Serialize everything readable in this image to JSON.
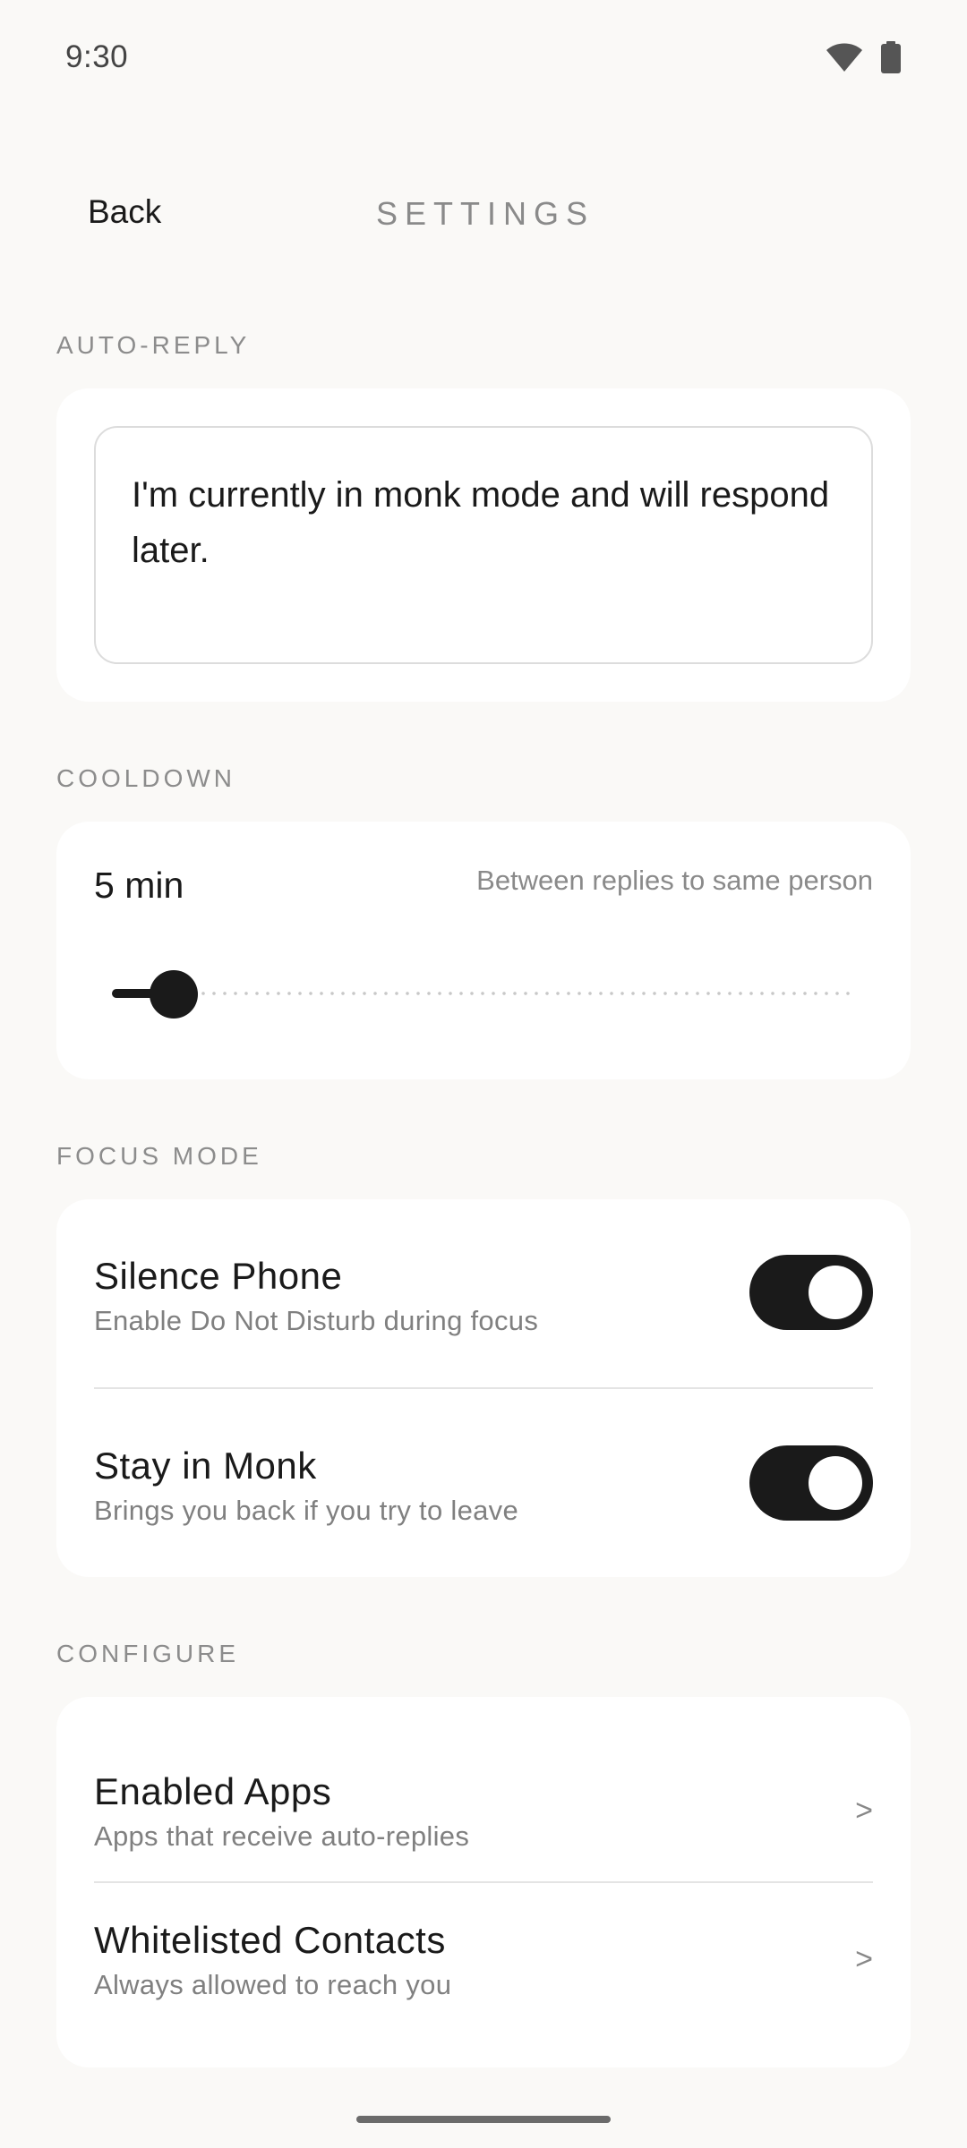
{
  "status_bar": {
    "time": "9:30",
    "wifi_icon": "wifi-icon",
    "battery_icon": "battery-icon"
  },
  "header": {
    "back_label": "Back",
    "title": "SETTINGS"
  },
  "auto_reply": {
    "section_label": "AUTO-REPLY",
    "message": "I'm currently in monk mode and will respond later."
  },
  "cooldown": {
    "section_label": "COOLDOWN",
    "value_label": "5 min",
    "description": "Between replies to same person",
    "slider_fraction": 0.05
  },
  "focus_mode": {
    "section_label": "FOCUS MODE",
    "items": [
      {
        "title": "Silence Phone",
        "subtitle": "Enable Do Not Disturb during focus",
        "enabled": true
      },
      {
        "title": "Stay in Monk",
        "subtitle": "Brings you back if you try to leave",
        "enabled": true
      }
    ]
  },
  "configure": {
    "section_label": "CONFIGURE",
    "items": [
      {
        "title": "Enabled Apps",
        "subtitle": "Apps that receive auto-replies",
        "chevron": ">"
      },
      {
        "title": "Whitelisted Contacts",
        "subtitle": "Always allowed to reach you",
        "chevron": ">"
      }
    ]
  },
  "colors": {
    "background": "#FAF9F7",
    "card": "#ffffff",
    "accent": "#1a1a1a",
    "muted": "#8a8a8a"
  }
}
